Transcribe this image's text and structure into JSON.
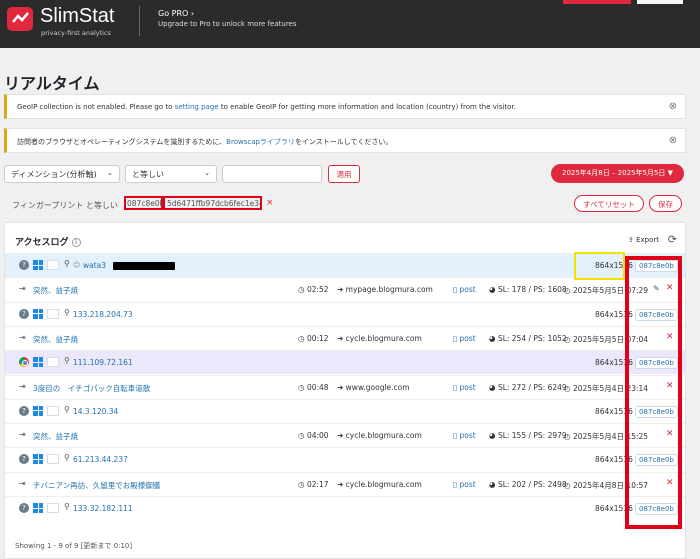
{
  "header": {
    "brand": "SlimStat",
    "tagline": "privacy-first analytics",
    "gopro_label": "Go PRO",
    "gopro_chevron": "›",
    "gopro_sub": "Upgrade to Pro to unlock more features"
  },
  "page": {
    "title": "リアルタイム"
  },
  "notices": [
    {
      "before": "GeoIP collection is not enabled. Please go to ",
      "link": "setting page",
      "after": " to enable GeoIP for getting more information and location (country) from the visitor.",
      "dismiss": "⊗"
    },
    {
      "before": "訪問者のブラウザとオペレーティングシステムを識別するために、",
      "link": "Browscapライブラリ",
      "after": "をインストールしてください。",
      "dismiss": "⊗"
    }
  ],
  "filters": {
    "dimension_label": "ディメンション(分析軸)",
    "operator_label": "と等しい",
    "value": "",
    "apply_label": "適用",
    "date_range": "2025年4月8日 – 2025年5月5日",
    "date_caret": "▼"
  },
  "active_filter": {
    "label": "フィンガープリント と等しい",
    "value_part1": "087c8e0b",
    "value_part2": "5d6471ffb97dcb6fec1e34c",
    "remove": "×",
    "reset_label": "すべてリセット",
    "save_label": "保存"
  },
  "access_log": {
    "title": "アクセスログ",
    "info": "i",
    "export_label": "Export",
    "export_icon": "⇪",
    "refresh_icon": "⟳",
    "footer": "Showing 1 - 9 of 9 [更新まで 0:10]",
    "rows": [
      {
        "type": "visitor",
        "highlight": "blue",
        "browser": "unknown",
        "gravatar": "☺",
        "label": "wata3",
        "is_user": true,
        "resolution": "864x1536",
        "fingerprint": "087c8e0b"
      },
      {
        "type": "page",
        "title": "突然、益子焼",
        "duration": "02:52",
        "referrer": "mypage.blogmura.com",
        "content": "post",
        "sl": "SL: 178 / PS: 1608",
        "time": "2025年5月5日 07:29",
        "edit": true
      },
      {
        "type": "visitor",
        "highlight": "",
        "browser": "unknown",
        "label": "133.218.204.73",
        "resolution": "864x1536",
        "fingerprint": "087c8e0b"
      },
      {
        "type": "page",
        "title": "突然、益子焼",
        "duration": "00:12",
        "referrer": "cycle.blogmura.com",
        "content": "post",
        "sl": "SL: 254 / PS: 1052",
        "time": "2025年5月5日 07:04",
        "edit": false
      },
      {
        "type": "visitor",
        "highlight": "purple",
        "browser": "chrome",
        "label": "111.109.72.161",
        "resolution": "864x1536",
        "fingerprint": "087c8e0b"
      },
      {
        "type": "page",
        "title": "3度目の　イチゴパック自転車道散",
        "duration": "00:48",
        "referrer": "www.google.com",
        "content": "post",
        "sl": "SL: 272 / PS: 6249",
        "time": "2025年5月4日 23:14",
        "edit": false
      },
      {
        "type": "visitor",
        "highlight": "",
        "browser": "unknown",
        "label": "14.3.120.34",
        "resolution": "864x1536",
        "fingerprint": "087c8e0b"
      },
      {
        "type": "page",
        "title": "突然、益子焼",
        "duration": "04:00",
        "referrer": "cycle.blogmura.com",
        "content": "post",
        "sl": "SL: 155 / PS: 2979",
        "time": "2025年5月4日 15:25",
        "edit": false
      },
      {
        "type": "visitor",
        "highlight": "",
        "browser": "unknown",
        "label": "61.213.44.237",
        "resolution": "864x1536",
        "fingerprint": "087c8e0b"
      },
      {
        "type": "page",
        "title": "チバニアン再訪、久留里でお殿様御膳",
        "duration": "02:17",
        "referrer": "cycle.blogmura.com",
        "content": "post",
        "sl": "SL: 202 / PS: 2498",
        "time": "2025年4月8日 10:57",
        "edit": false
      },
      {
        "type": "visitor",
        "highlight": "",
        "browser": "unknown",
        "label": "133.32.182.111",
        "resolution": "864x1536",
        "fingerprint": "087c8e0b"
      }
    ]
  },
  "colors": {
    "accent": "#e0293e",
    "link": "#2271b1",
    "highlight_blue": "#e2f1fc",
    "highlight_purple": "#ece8fb",
    "annotation_red": "#e0001a",
    "annotation_yellow": "#f2e400"
  }
}
